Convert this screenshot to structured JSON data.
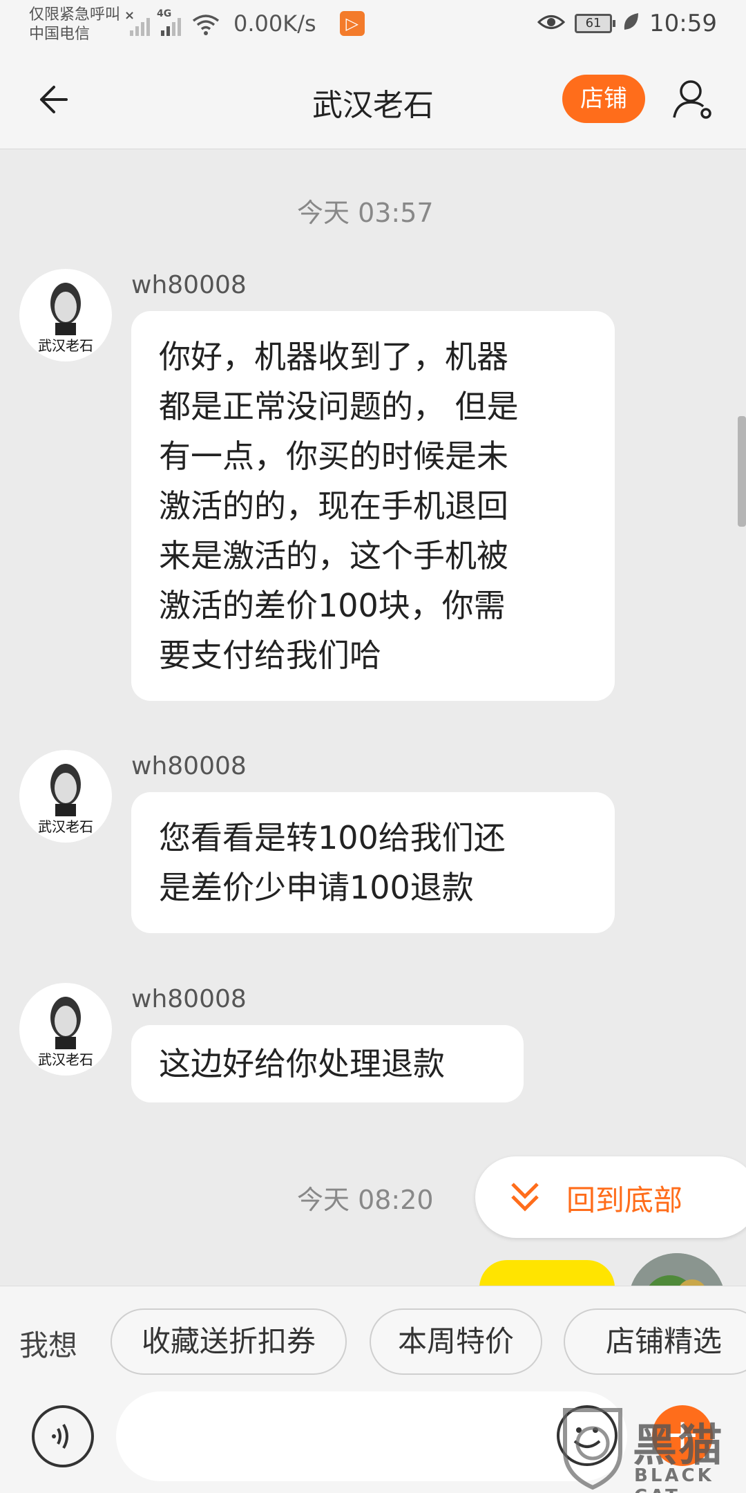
{
  "status_bar": {
    "emergency_text": "仅限紧急呼叫",
    "carrier": "中国电信",
    "network_tag": "4G",
    "net_speed": "0.00K/s",
    "battery": "61",
    "time": "10:59"
  },
  "header": {
    "title": "武汉老石",
    "shop_label": "店铺"
  },
  "messages": [
    {
      "timestamp": "今天  03:57",
      "sender": "wh80008",
      "lines": [
        "你好，机器收到了，机器",
        "都是正常没问题的， 但是",
        "有一点，你买的时候是未",
        "激活的的，现在手机退回",
        "来是激活的，这个手机被",
        "激活的差价100块，你需",
        "要支付给我们哈"
      ]
    },
    {
      "sender": "wh80008",
      "lines": [
        "您看看是转100给我们还",
        "是差价少申请100退款"
      ]
    },
    {
      "sender": "wh80008",
      "lines": [
        "这边好给你处理退款"
      ]
    },
    {
      "timestamp": "今天  08:20"
    }
  ],
  "avatar_text": "武汉老石",
  "back_to_bottom": "回到底部",
  "quick_bar": {
    "label": "我想",
    "chips": [
      "收藏送折扣券",
      "本周特价",
      "店铺精选"
    ]
  },
  "input": {
    "value": ""
  },
  "watermark": {
    "cn": "黑猫",
    "en": "BLACK CAT"
  },
  "colors": {
    "accent": "#ff6d1b",
    "self_bubble": "#ffe400",
    "background": "#ebebeb"
  }
}
